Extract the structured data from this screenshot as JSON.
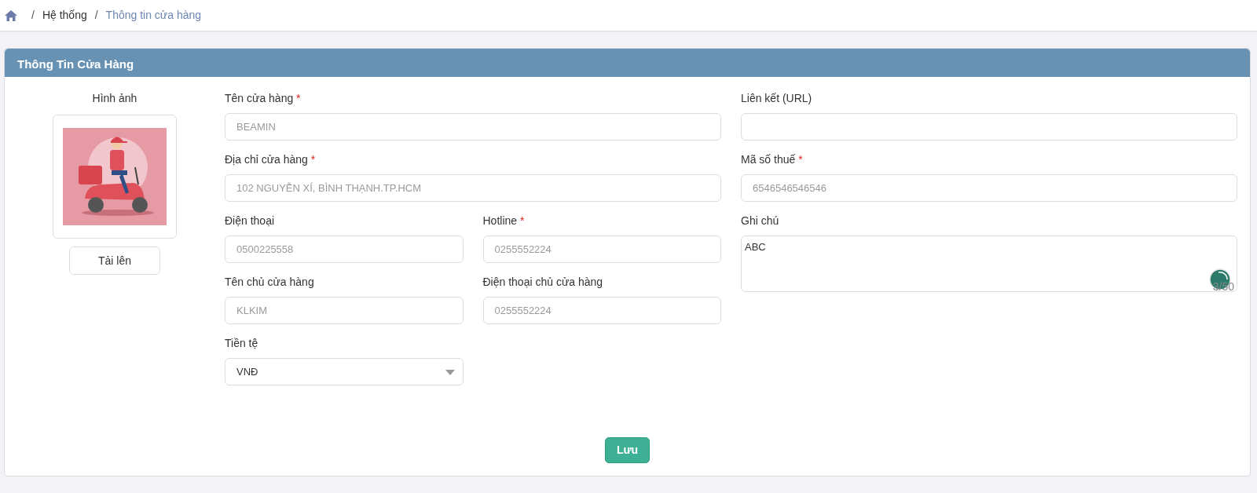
{
  "breadcrumb": {
    "items": [
      {
        "separator": "/",
        "label": "Hệ thống",
        "current": false
      },
      {
        "separator": "/",
        "label": "Thông tin cửa hàng",
        "current": true
      }
    ]
  },
  "card": {
    "title": "Thông Tin Cửa Hàng"
  },
  "image_panel": {
    "label": "Hình ảnh",
    "upload_button": "Tải lên"
  },
  "form": {
    "left_rows": [
      [
        {
          "kind": "input",
          "label": "Tên cửa hàng",
          "required_mark": "*",
          "value": "BEAMIN",
          "disabled": true
        }
      ],
      [
        {
          "kind": "input",
          "label": "Địa chỉ cửa hàng",
          "required_mark": "*",
          "value": "102 NGUYỄN XÍ, BÌNH THẠNH.TP.HCM",
          "disabled": true
        }
      ],
      [
        {
          "kind": "input",
          "label": "Điện thoại",
          "value": "0500225558",
          "disabled": true
        },
        {
          "kind": "input",
          "label": "Hotline",
          "required_mark": "*",
          "value": "0255552224",
          "disabled": true
        }
      ],
      [
        {
          "kind": "input",
          "label": "Tên chủ cửa hàng",
          "value": "KLKIM",
          "disabled": true
        },
        {
          "kind": "input",
          "label": "Điện thoại chủ cửa hàng",
          "value": "0255552224",
          "disabled": true
        }
      ],
      [
        {
          "kind": "select",
          "label": "Tiền tệ",
          "value": "VNĐ",
          "disabled": false
        }
      ]
    ],
    "right_fields": [
      {
        "kind": "input",
        "label": "Liên kết (URL)"
      },
      {
        "kind": "input",
        "label": "Mã số thuế",
        "required_mark": "*",
        "value": "6546546546546",
        "disabled": true
      },
      {
        "kind": "textarea",
        "label": "Ghi chú",
        "value": "ABC",
        "counter": "3/50"
      }
    ]
  },
  "save_button": "Lưu"
}
